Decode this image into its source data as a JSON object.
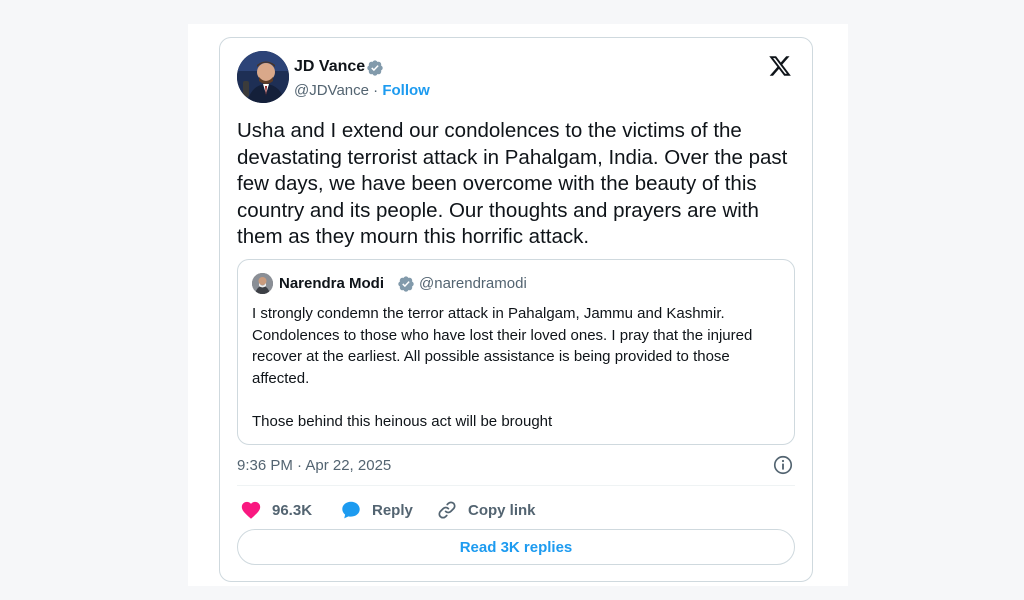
{
  "colors": {
    "accent": "#1d9bf0",
    "text_primary": "#0f1419",
    "text_secondary": "#536471",
    "like": "#f91880",
    "verified_badge": "#829aab",
    "border": "#cfd9de"
  },
  "tweet": {
    "author_name": "JD Vance",
    "author_handle": "@JDVance",
    "handle_separator": "·",
    "follow_label": "Follow",
    "body": "Usha and I extend our condolences to the victims of the devastating terrorist attack in Pahalgam, India. Over the past few days, we have been overcome with the beauty of this country and its people. Our thoughts and prayers are with them as they mourn this horrific attack.",
    "timestamp": "9:36 PM · Apr 22, 2025",
    "brand_icon": "x-logo-icon"
  },
  "quoted_tweet": {
    "author_name": "Narendra Modi",
    "author_handle": "@narendramodi",
    "body": "I strongly condemn the terror attack in Pahalgam, Jammu and Kashmir. Condolences to those who have lost their loved ones. I pray that the injured recover at the earliest. All possible assistance is being provided to those affected.\n\nThose behind this heinous act will be brought"
  },
  "actions": {
    "like_count": "96.3K",
    "reply_label": "Reply",
    "copy_link_label": "Copy link",
    "read_replies_label": "Read 3K replies"
  }
}
